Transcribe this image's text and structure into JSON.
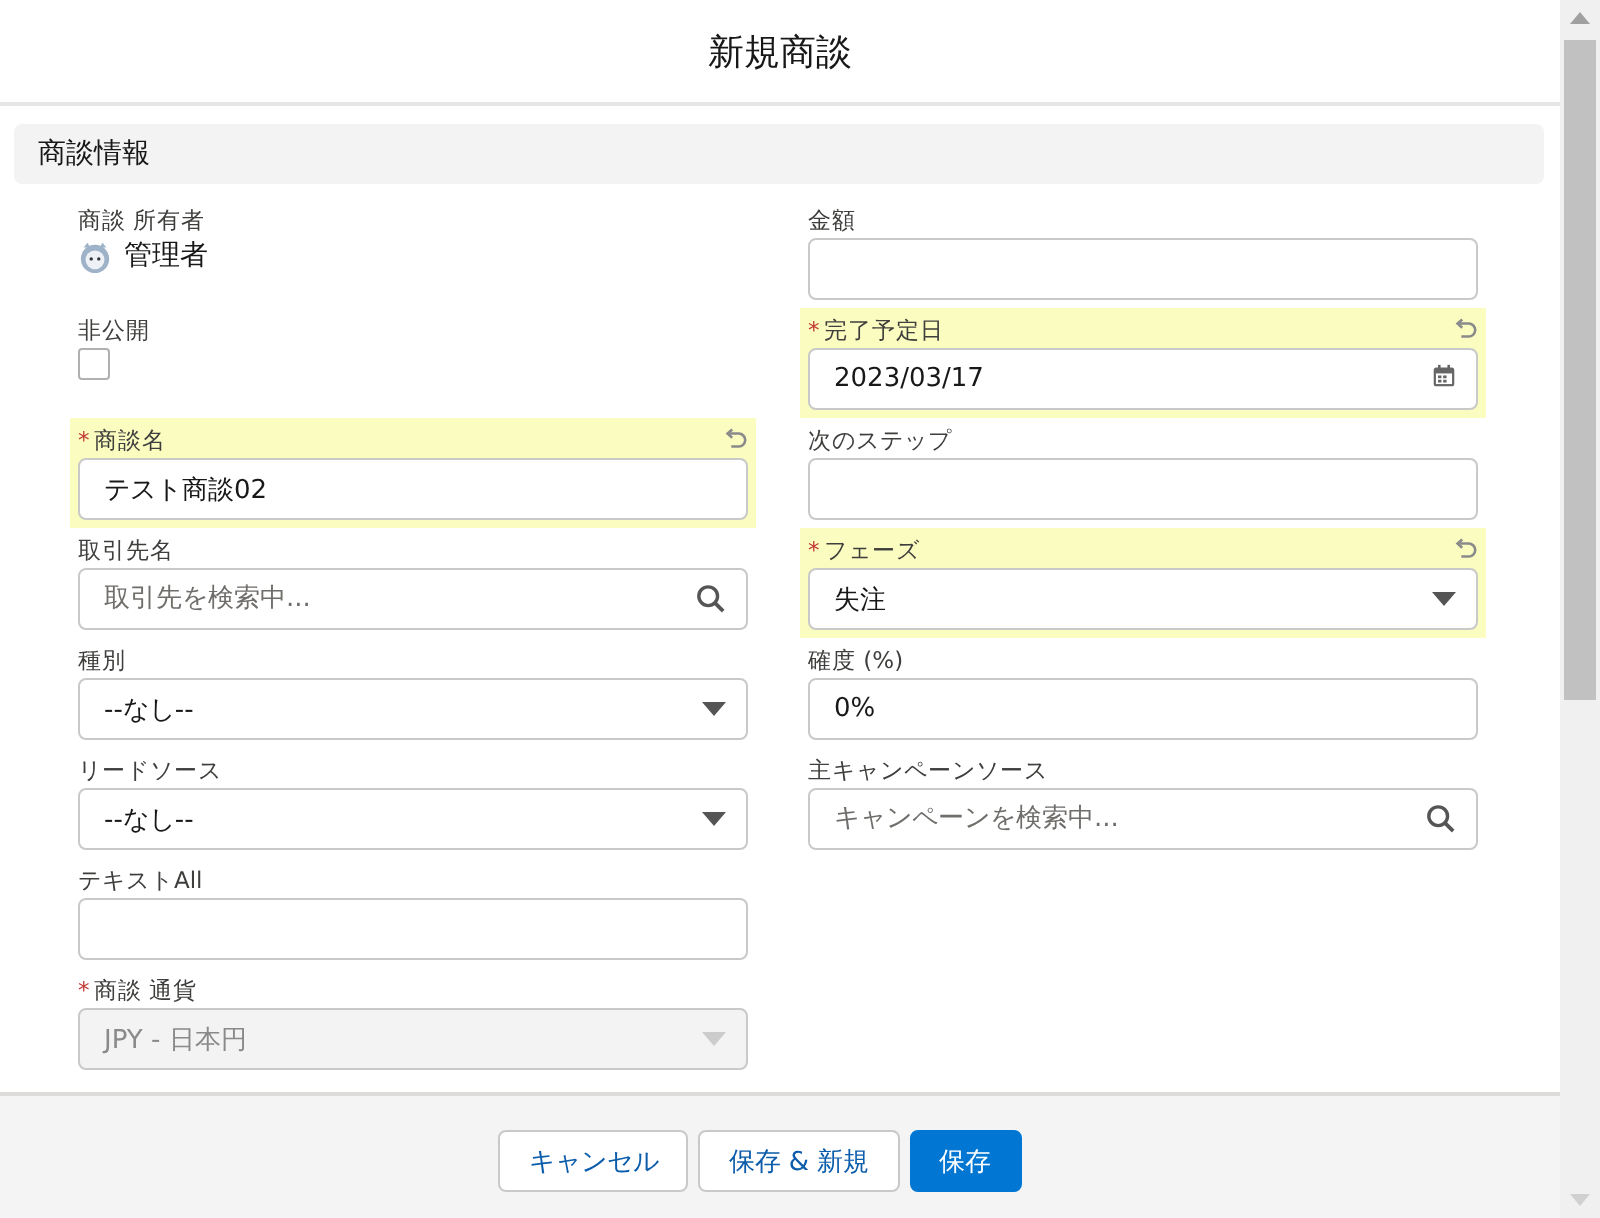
{
  "dialog": {
    "title": "新規商談"
  },
  "section": {
    "title": "商談情報"
  },
  "left_fields": [
    {
      "kind": "user",
      "label": "商談 所有者",
      "value": "管理者",
      "changed": false
    },
    {
      "kind": "checkbox",
      "label": "非公開",
      "checked": false,
      "changed": false
    },
    {
      "kind": "text",
      "label": "商談名",
      "value": "テスト商談02",
      "required_mark": "*",
      "changed": true
    },
    {
      "kind": "lookup",
      "label": "取引先名",
      "placeholder": "取引先を検索中...",
      "changed": false
    },
    {
      "kind": "picklist",
      "label": "種別",
      "value": "--なし--",
      "changed": false
    },
    {
      "kind": "picklist",
      "label": "リードソース",
      "value": "--なし--",
      "changed": false
    },
    {
      "kind": "text",
      "label": "テキストAll",
      "changed": false
    },
    {
      "kind": "picklist",
      "label": "商談 通貨",
      "value": "JPY - 日本円",
      "required_mark": "*",
      "changed": false,
      "disabled": true
    }
  ],
  "right_fields": [
    {
      "kind": "text",
      "label": "金額",
      "changed": false
    },
    {
      "kind": "date",
      "label": "完了予定日",
      "value": "2023/03/17",
      "required_mark": "*",
      "changed": true
    },
    {
      "kind": "text",
      "label": "次のステップ",
      "changed": false
    },
    {
      "kind": "picklist",
      "label": "フェーズ",
      "value": "失注",
      "required_mark": "*",
      "changed": true
    },
    {
      "kind": "text",
      "label": "確度 (%)",
      "value": "0%",
      "changed": false
    },
    {
      "kind": "lookup",
      "label": "主キャンペーンソース",
      "placeholder": "キャンペーンを検索中...",
      "changed": false
    }
  ],
  "buttons": [
    {
      "label": "キャンセル",
      "kind": "neutral"
    },
    {
      "label": "保存 & 新規",
      "kind": "neutral"
    },
    {
      "label": "保存",
      "kind": "brand"
    }
  ]
}
